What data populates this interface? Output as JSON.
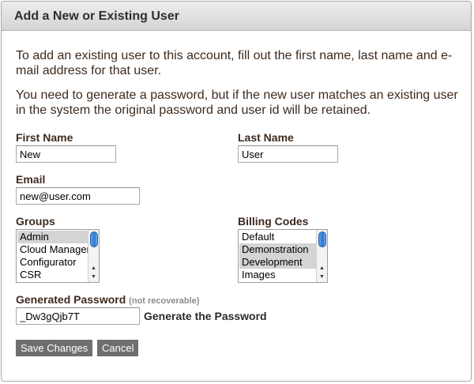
{
  "dialog": {
    "title": "Add a New or Existing User",
    "intro_1": "To add an existing user to this account, fill out the first name, last name and e-mail address for that user.",
    "intro_2": "You need to generate a password, but if the new user matches an existing user in the system the original password and user id will be retained."
  },
  "form": {
    "first_name": {
      "label": "First Name",
      "value": "New"
    },
    "last_name": {
      "label": "Last Name",
      "value": "User"
    },
    "email": {
      "label": "Email",
      "value": "new@user.com"
    },
    "groups": {
      "label": "Groups",
      "options": [
        "Admin",
        "Cloud Manager",
        "Configurator",
        "CSR"
      ],
      "selected": [
        "Admin"
      ]
    },
    "billing_codes": {
      "label": "Billing Codes",
      "options": [
        "Default",
        "Demonstration",
        "Development",
        "Images"
      ],
      "selected": [
        "Demonstration",
        "Development"
      ]
    },
    "password": {
      "label": "Generated Password",
      "note": "(not recoverable)",
      "value": "_Dw3gQjb7T",
      "generate_label": "Generate the Password"
    }
  },
  "actions": {
    "save_label": "Save Changes",
    "cancel_label": "Cancel"
  },
  "icons": {
    "scroll_up": "scroll-up-arrow-icon",
    "scroll_down": "scroll-down-arrow-icon"
  }
}
